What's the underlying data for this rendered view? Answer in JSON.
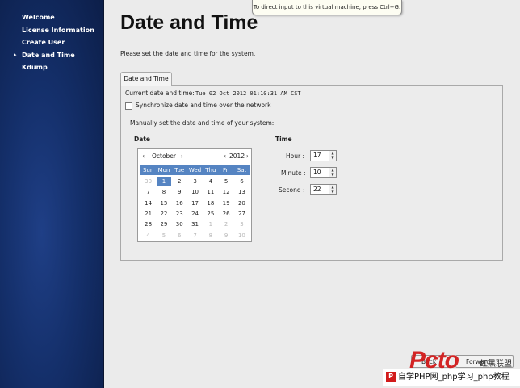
{
  "tooltip": "To direct input to this virtual machine, press Ctrl+G.",
  "sidebar": {
    "items": [
      {
        "label": "Welcome"
      },
      {
        "label": "License Information"
      },
      {
        "label": "Create User"
      },
      {
        "label": "Date and Time",
        "selected": true
      },
      {
        "label": "Kdump"
      }
    ]
  },
  "page": {
    "title": "Date and Time",
    "subtitle": "Please set the date and time for the system."
  },
  "tab": {
    "label": "Date and Time"
  },
  "current": {
    "label": "Current date and time:",
    "value": "Tue 02 Oct 2012 01:10:31 AM CST"
  },
  "sync": {
    "label": "Synchronize date and time over the network",
    "checked": false
  },
  "manual_label": "Manually set the date and time of your system:",
  "date_heading": "Date",
  "time_heading": "Time",
  "calendar": {
    "month": "October",
    "year": "2012",
    "prev_month": "‹",
    "next_month": "›",
    "prev_year": "‹",
    "next_year": "›",
    "weekdays": [
      "Sun",
      "Mon",
      "Tue",
      "Wed",
      "Thu",
      "Fri",
      "Sat"
    ],
    "rows": [
      [
        "30",
        "1",
        "2",
        "3",
        "4",
        "5",
        "6"
      ],
      [
        "7",
        "8",
        "9",
        "10",
        "11",
        "12",
        "13"
      ],
      [
        "14",
        "15",
        "16",
        "17",
        "18",
        "19",
        "20"
      ],
      [
        "21",
        "22",
        "23",
        "24",
        "25",
        "26",
        "27"
      ],
      [
        "28",
        "29",
        "30",
        "31",
        "1",
        "2",
        "3"
      ],
      [
        "4",
        "5",
        "6",
        "7",
        "8",
        "9",
        "10"
      ]
    ],
    "selected": "1"
  },
  "time": {
    "hour": {
      "label": "Hour :",
      "value": "17"
    },
    "minute": {
      "label": "Minute :",
      "value": "10"
    },
    "second": {
      "label": "Second :",
      "value": "22"
    }
  },
  "buttons": {
    "back": "Back",
    "forward": "Forward"
  },
  "watermark": {
    "logo": "Pcto",
    "brand": "红黑联盟",
    "footer": "自学PHP网_php学习_php教程",
    "footer_icon": "P"
  },
  "colors": {
    "accent": "#5584c2",
    "sidebar": "#142f6a",
    "watermark_red": "#d21b1b"
  }
}
